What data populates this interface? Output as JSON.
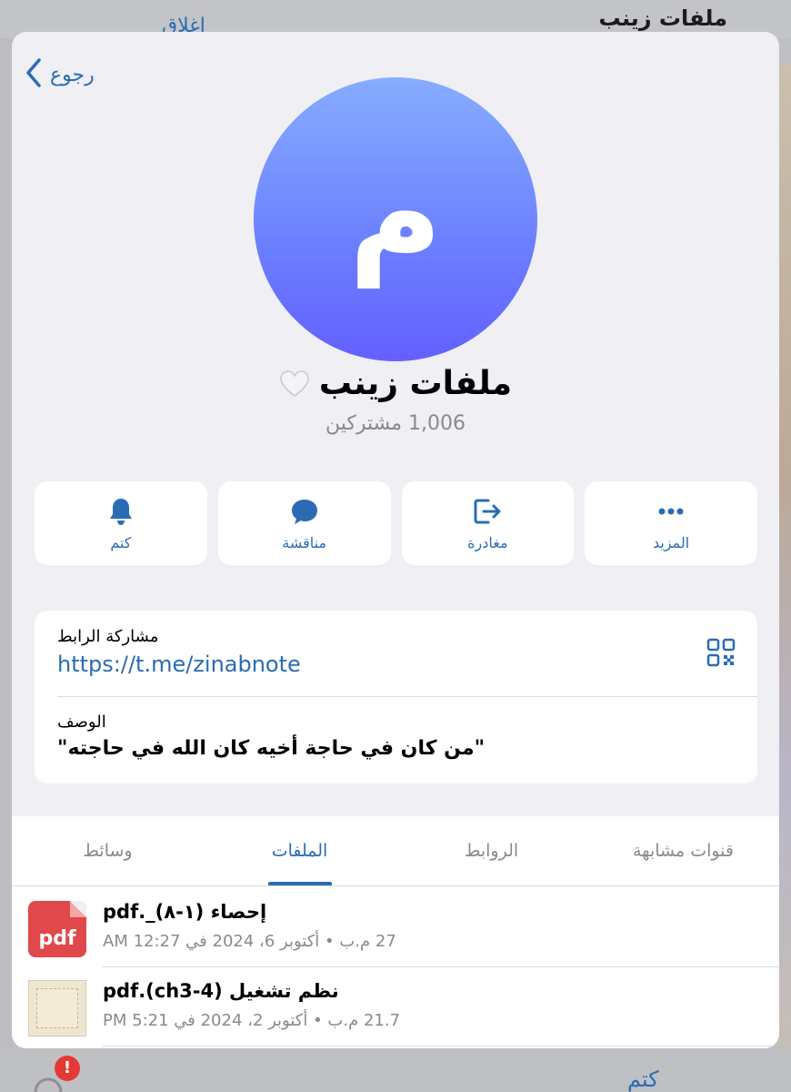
{
  "background": {
    "title": "ملفات زينب",
    "close_label": "إغلاق",
    "mute_label": "كتم",
    "badge": "!"
  },
  "header": {
    "back_label": "رجوع"
  },
  "channel": {
    "avatar_letter": "م",
    "name": "ملفات زينب",
    "subscribers": "1,006 مشتركين"
  },
  "actions": {
    "more": "المزيد",
    "leave": "مغادرة",
    "discussion": "مناقشة",
    "mute": "كتم"
  },
  "info": {
    "share_label": "مشاركة الرابط",
    "share_link": "https://t.me/zinabnote",
    "description_label": "الوصف",
    "description": "\"من كان في حاجة أخيه كان الله في حاجته\""
  },
  "tabs": {
    "similar_channels": "قنوات مشابهة",
    "links": "الروابط",
    "files": "الملفات",
    "media": "وسائط",
    "active": "files"
  },
  "files": [
    {
      "name": "إحصاء (١-٨)_.pdf",
      "meta": "27 م.ب • أكتوبر 6، 2024 في 12:27 AM",
      "thumb_label": "pdf"
    },
    {
      "name": "نظم تشغيل (ch3-4).pdf",
      "meta": "21.7 م.ب • أكتوبر 2، 2024 في 5:21 PM",
      "thumb_label": ""
    }
  ],
  "colors": {
    "accent": "#2a6cb4",
    "avatar_top": "#86adff",
    "avatar_bottom": "#6460ff",
    "pdf_red": "#e0484b"
  }
}
